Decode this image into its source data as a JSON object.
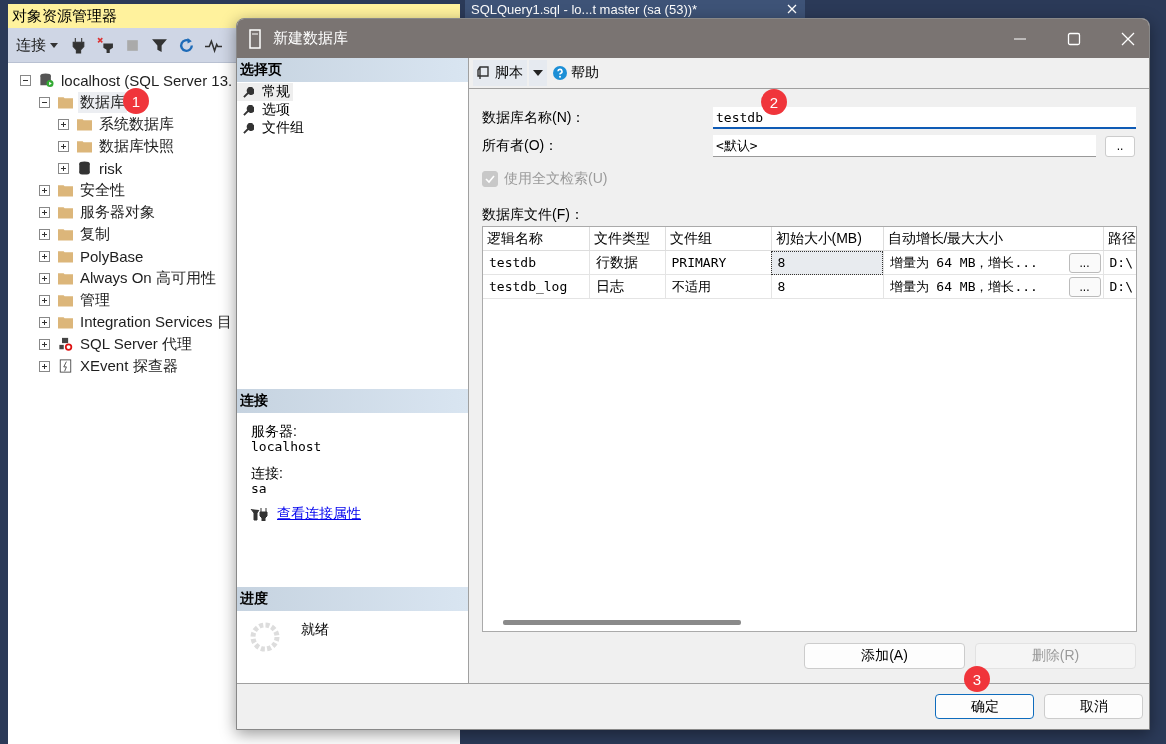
{
  "explorer": {
    "title": "对象资源管理器",
    "connect_label": "连接",
    "tree": [
      {
        "label": "localhost (SQL Server 13.",
        "kind": "server",
        "expanded": true,
        "selected": false,
        "children": [
          {
            "label": "数据库",
            "kind": "folder",
            "expanded": true,
            "selected": true,
            "children": [
              {
                "label": "系统数据库",
                "kind": "folder",
                "expanded": false,
                "selected": false
              },
              {
                "label": "数据库快照",
                "kind": "folder",
                "expanded": false,
                "selected": false
              },
              {
                "label": "risk",
                "kind": "database",
                "expanded": false,
                "selected": false
              }
            ]
          },
          {
            "label": "安全性",
            "kind": "folder",
            "expanded": false,
            "selected": false
          },
          {
            "label": "服务器对象",
            "kind": "folder",
            "expanded": false,
            "selected": false
          },
          {
            "label": "复制",
            "kind": "folder",
            "expanded": false,
            "selected": false
          },
          {
            "label": "PolyBase",
            "kind": "folder",
            "expanded": false,
            "selected": false
          },
          {
            "label": "Always On 高可用性",
            "kind": "folder",
            "expanded": false,
            "selected": false
          },
          {
            "label": "管理",
            "kind": "folder",
            "expanded": false,
            "selected": false
          },
          {
            "label": "Integration Services 目",
            "kind": "folder",
            "expanded": false,
            "selected": false
          },
          {
            "label": "SQL Server 代理",
            "kind": "agent",
            "expanded": false,
            "selected": false
          },
          {
            "label": "XEvent 探查器",
            "kind": "xevent",
            "expanded": false,
            "selected": false
          }
        ]
      }
    ]
  },
  "editor_tab": {
    "title": "SQLQuery1.sql - lo...t master (sa (53))*"
  },
  "dialog": {
    "title": "新建数据库",
    "pages_header": "选择页",
    "pages": [
      {
        "label": "常规",
        "selected": true
      },
      {
        "label": "选项",
        "selected": false
      },
      {
        "label": "文件组",
        "selected": false
      }
    ],
    "connection_header": "连接",
    "server_label": "服务器:",
    "server": "localhost",
    "connection_label": "连接:",
    "connection": "sa",
    "connection_link": "查看连接属性",
    "progress_header": "进度",
    "progress_status": "就绪",
    "toolbar": {
      "script": "脚本",
      "help": "帮助"
    },
    "name_label": "数据库名称(N)：",
    "name_value": "testdb",
    "owner_label": "所有者(O)：",
    "owner_value": "<默认>",
    "owner_browse": "..",
    "fulltext": {
      "label": "使用全文检索(U)",
      "checked": true,
      "disabled": true
    },
    "files_label": "数据库文件(F)：",
    "columns": [
      "逻辑名称",
      "文件类型",
      "文件组",
      "初始大小(MB)",
      "自动增长/最大大小",
      "路径"
    ],
    "rows": [
      {
        "logical_name": "testdb",
        "file_type": "行数据",
        "filegroup": "PRIMARY",
        "initial_size": "8",
        "size_focused": true,
        "autogrowth": "增量为 64 MB，增长...",
        "browse": "...",
        "path": "D:\\"
      },
      {
        "logical_name": "testdb_log",
        "file_type": "日志",
        "filegroup": "不适用",
        "initial_size": "8",
        "size_focused": false,
        "autogrowth": "增量为 64 MB，增长...",
        "browse": "...",
        "path": "D:\\"
      }
    ],
    "add_button": {
      "label": "添加(A)",
      "disabled": false
    },
    "remove_button": {
      "label": "删除(R)",
      "disabled": true
    },
    "ok_button": "确定",
    "cancel_button": "取消"
  },
  "annotations": [
    {
      "text": "1"
    },
    {
      "text": "2"
    },
    {
      "text": "3"
    }
  ]
}
